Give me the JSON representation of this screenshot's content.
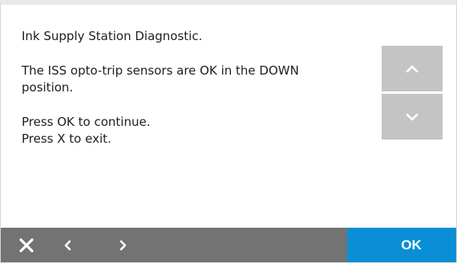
{
  "message": {
    "title": "Ink Supply Station Diagnostic.",
    "status_line_1": "The ISS opto-trip sensors are OK in the DOWN",
    "status_line_2": "position.",
    "instruction_continue": "Press OK to continue.",
    "instruction_exit": "Press X to exit."
  },
  "scroll": {
    "up_icon": "chevron-up-icon",
    "down_icon": "chevron-down-icon"
  },
  "toolbar": {
    "ok_label": "OK",
    "close_icon": "close-icon",
    "prev_icon": "chevron-left-icon",
    "next_icon": "chevron-right-icon"
  },
  "colors": {
    "background": "#ffffff",
    "text": "#1e1e1e",
    "scroll_button": "#c4c4c4",
    "toolbar": "#737373",
    "ok_button": "#0a8fd6"
  }
}
